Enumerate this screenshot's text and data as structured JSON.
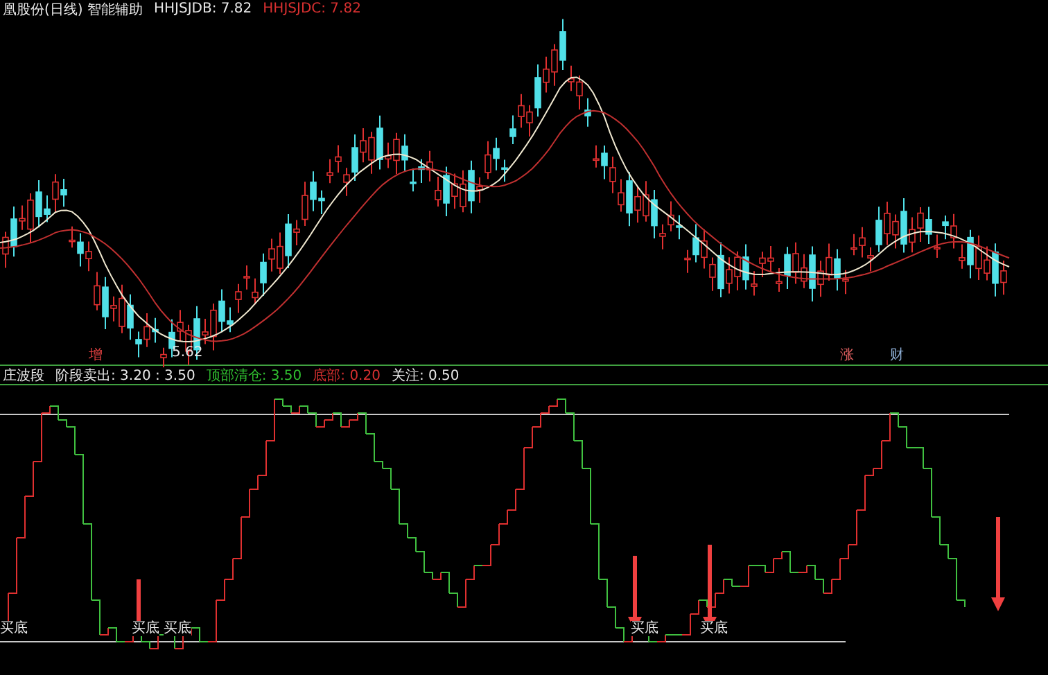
{
  "header": {
    "title": "凰股份(日线) 智能辅助",
    "readings": [
      {
        "label": "HHJSJDB: 7.82",
        "color": "#e8e8e8"
      },
      {
        "label": "HHJSJDC: 7.82",
        "color": "#d83030"
      }
    ]
  },
  "price_chart": {
    "low_label": "5.62",
    "signals": [
      {
        "label": "增",
        "color": "#e04040"
      },
      {
        "label": "涨",
        "color": "#e06060"
      },
      {
        "label": "财",
        "color": "#8fb0d8"
      }
    ]
  },
  "indicator": {
    "title": "庄波段",
    "readings": [
      {
        "label": "阶段卖出: 3.20 : 3.50",
        "color": "#e8e8e8"
      },
      {
        "label": "顶部清仓: 3.50",
        "color": "#30c030"
      },
      {
        "label": "底部: 0.20",
        "color": "#d83030"
      },
      {
        "label": "关注: 0.50",
        "color": "#e8e8e8"
      }
    ],
    "buy_labels": [
      "买底",
      "买底",
      "买底",
      "买底",
      "买底"
    ]
  }
}
